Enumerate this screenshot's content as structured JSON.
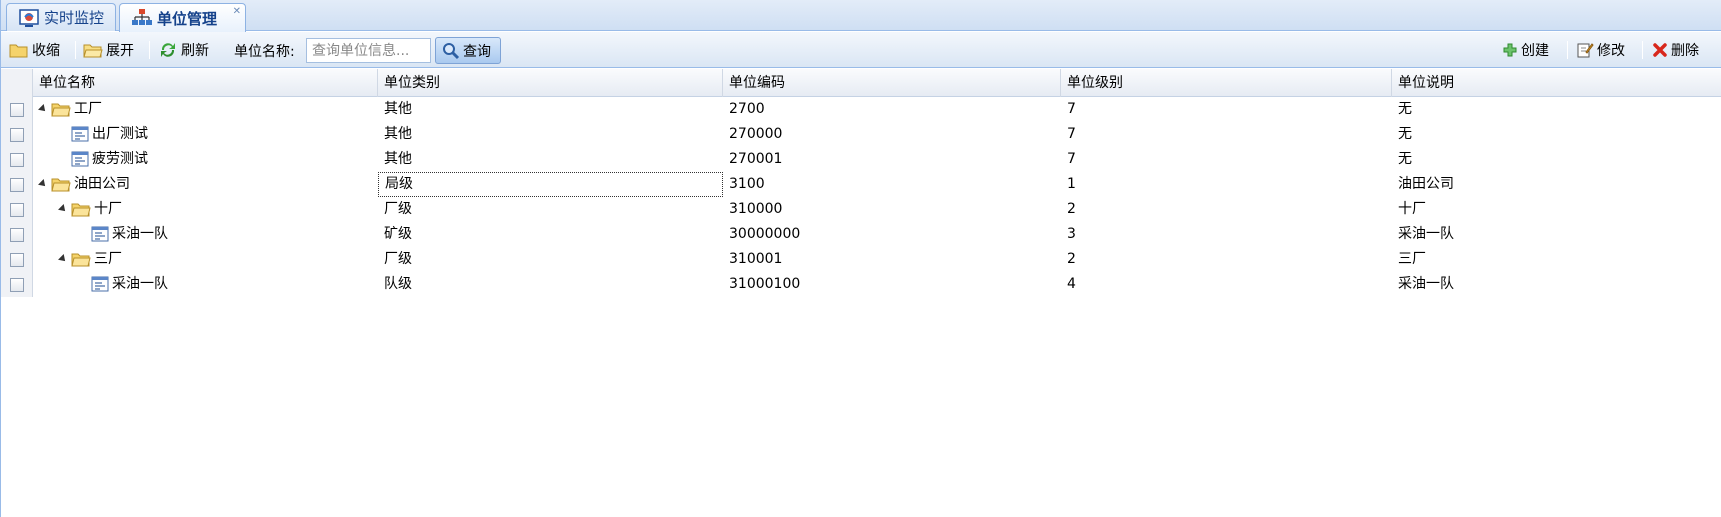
{
  "tabs": [
    {
      "label": "实时监控",
      "icon": "monitor-icon",
      "active": false
    },
    {
      "label": "单位管理",
      "icon": "org-chart-icon",
      "active": true
    }
  ],
  "toolbar": {
    "collapse_label": "收缩",
    "expand_label": "展开",
    "refresh_label": "刷新",
    "unit_name_label": "单位名称:",
    "search_placeholder": "查询单位信息...",
    "search_button": "查询",
    "create_label": "创建",
    "edit_label": "修改",
    "delete_label": "删除"
  },
  "columns": [
    "单位名称",
    "单位类别",
    "单位编码",
    "单位级别",
    "单位说明"
  ],
  "rows": [
    {
      "name": "工厂",
      "type": "其他",
      "code": "2700",
      "level": "7",
      "desc": "无",
      "depth": 0,
      "kind": "folder",
      "expanded": true
    },
    {
      "name": "出厂测试",
      "type": "其他",
      "code": "270000",
      "level": "7",
      "desc": "无",
      "depth": 1,
      "kind": "leaf"
    },
    {
      "name": "疲劳测试",
      "type": "其他",
      "code": "270001",
      "level": "7",
      "desc": "无",
      "depth": 1,
      "kind": "leaf"
    },
    {
      "name": "油田公司",
      "type": "局级",
      "code": "3100",
      "level": "1",
      "desc": "油田公司",
      "depth": 0,
      "kind": "folder",
      "expanded": true,
      "selected": true
    },
    {
      "name": "十厂",
      "type": "厂级",
      "code": "310000",
      "level": "2",
      "desc": "十厂",
      "depth": 1,
      "kind": "folder",
      "expanded": true
    },
    {
      "name": "采油一队",
      "type": "矿级",
      "code": "30000000",
      "level": "3",
      "desc": "采油一队",
      "depth": 2,
      "kind": "leaf"
    },
    {
      "name": "三厂",
      "type": "厂级",
      "code": "310001",
      "level": "2",
      "desc": "三厂",
      "depth": 1,
      "kind": "folder",
      "expanded": true
    },
    {
      "name": "采油一队",
      "type": "队级",
      "code": "31000100",
      "level": "4",
      "desc": "采油一队",
      "depth": 2,
      "kind": "leaf"
    }
  ],
  "colors": {
    "accent": "#15428b",
    "border": "#99bbe8"
  }
}
